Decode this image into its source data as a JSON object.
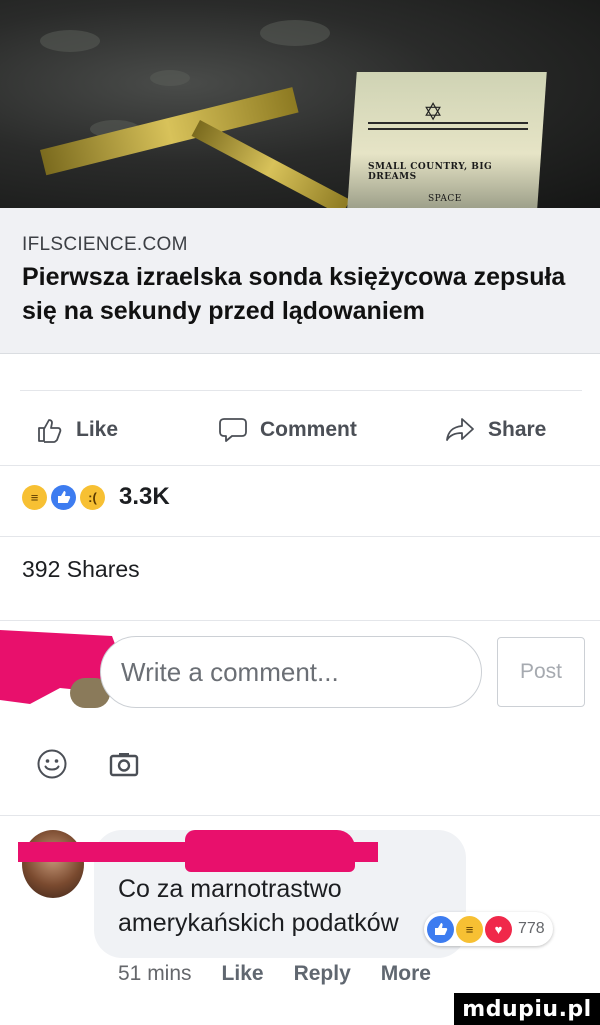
{
  "preview": {
    "domain": "IFLSCIENCE.COM",
    "headline": "Pierwsza izraelska sonda księżycowa zepsuła się na sekundy przed lądowaniem",
    "image": {
      "plaque_text": "SMALL COUNTRY, BIG DREAMS",
      "plaque_subtext": "SPACE"
    }
  },
  "actions": {
    "like": "Like",
    "comment": "Comment",
    "share": "Share"
  },
  "reactions": {
    "icons": [
      "haha-icon",
      "like-icon",
      "sad-icon"
    ],
    "count": "3.3K"
  },
  "shares": "392 Shares",
  "composer": {
    "placeholder": "Write a comment...",
    "post_label": "Post"
  },
  "comment": {
    "text": "Co za marnotrastwo amerykańskich podatków",
    "reaction_count": "778",
    "time": "51 mins",
    "like": "Like",
    "reply": "Reply",
    "more": "More"
  },
  "watermark": "mdupiu.pl",
  "colors": {
    "redaction": "#e8106c",
    "like_blue": "#3d7cf0",
    "love_red": "#f0284a",
    "haha_yellow": "#f7c033"
  }
}
